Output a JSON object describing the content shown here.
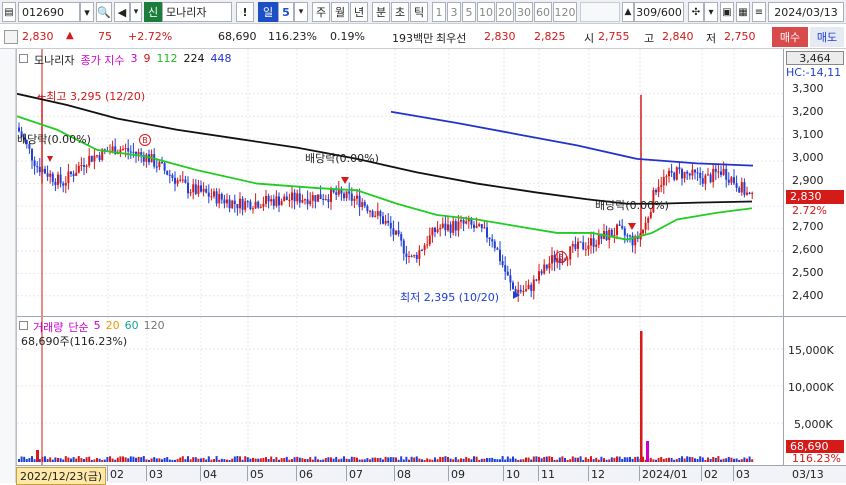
{
  "toolbar": {
    "stock_code": "012690",
    "market_badge": "신",
    "stock_name": "모나리자",
    "alert": "!",
    "period_selected": "일",
    "period_num": "5",
    "periods": [
      "주",
      "월",
      "년",
      "분",
      "초",
      "틱"
    ],
    "intervals": [
      "1",
      "3",
      "5",
      "10",
      "20",
      "30",
      "60",
      "120"
    ],
    "count": "309/600",
    "date": "2024/03/13"
  },
  "status": {
    "price": "2,830",
    "change": "75",
    "change_pct": "+2.72%",
    "volume": "68,690",
    "vol_ratio": "116.23%",
    "turnover": "0.19%",
    "amount": "193백만",
    "best_ask_label": "최우선",
    "best_ask": "2,830",
    "best_bid": "2,825",
    "open_label": "시",
    "open": "2,755",
    "high_label": "고",
    "high": "2,840",
    "low_label": "저",
    "low": "2,750",
    "buy_label": "매수",
    "sell_label": "매도"
  },
  "legend": {
    "name": "모나리자",
    "ma_label": "종가 지수",
    "ma3": "3",
    "ma9": "9",
    "ma112": "112",
    "ma224": "224",
    "ma448": "448"
  },
  "annotations": {
    "high": "←최고 3,295 (12/20)",
    "low": "최저 2,395 (10/20)",
    "div1": "배당락(0.00%)",
    "div2": "배당락(0.00%)",
    "div3": "배당락(0.00%)",
    "b1": "B",
    "b2": "B",
    "hc": "HC:-14,11"
  },
  "vol_legend": {
    "label": "거래량",
    "ma_label": "단순",
    "m5": "5",
    "m20": "20",
    "m60": "60",
    "m120": "120",
    "summary": "68,690주(116.23%)"
  },
  "price_axis": {
    "top_value": "3,464",
    "ticks": [
      "3,300",
      "3,200",
      "3,100",
      "3,000",
      "2,900",
      "2,800",
      "2,700",
      "2,600",
      "2,500",
      "2,400"
    ],
    "current": "2,830",
    "current_pct": "2.72%"
  },
  "vol_axis": {
    "ticks": [
      "15,000K",
      "10,000K",
      "5,000K"
    ],
    "current": "68,690",
    "current_pct": "116.23%"
  },
  "x_axis": {
    "start_date": "2022/12/23(금)",
    "months": [
      "02",
      "03",
      "04",
      "05",
      "06",
      "07",
      "08",
      "09",
      "10",
      "11",
      "12",
      "2024/01",
      "02",
      "03"
    ],
    "end": "03/13"
  },
  "colors": {
    "up": "#d51a1a",
    "down": "#1f3fd6",
    "ma112": "#22cc22",
    "ma224": "#111111",
    "ma448": "#2233cc",
    "ma3": "#cc00cc",
    "ma9": "#d51a1a"
  },
  "chart_data": {
    "type": "candlestick",
    "price_range": [
      2350,
      3464
    ],
    "grid": true,
    "summary": {
      "high": 3295,
      "high_date": "12/20",
      "low": 2395,
      "low_date": "10/20",
      "last": 2830
    }
  }
}
